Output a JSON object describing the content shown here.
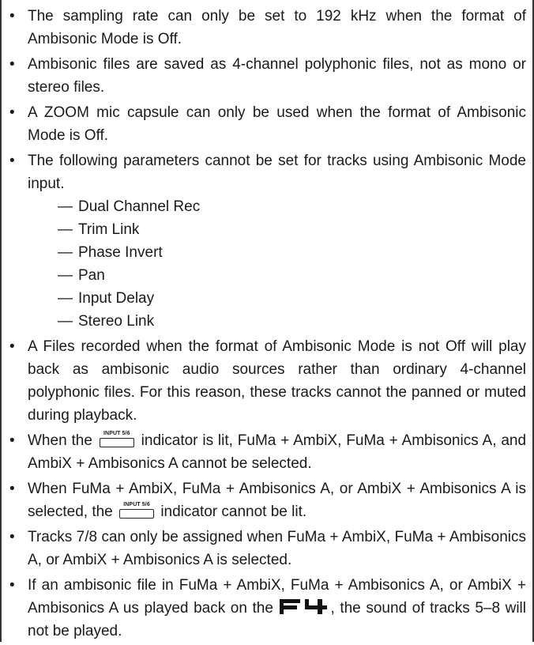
{
  "items": [
    "The sampling rate can only be set to 192 kHz when the format of Ambisonic Mode is Off.",
    "Ambisonic files are saved as 4-channel polyphonic files, not as mono or stereo files.",
    "A ZOOM mic capsule can only be used when the format of Ambi­sonic Mode is Off.",
    "The following parameters cannot be set for tracks using Ambisonic Mode input.",
    "A Files recorded when the format of Ambisonic Mode is not Off will play back as ambisonic audio sources rather than ordinary 4-channel polyphonic files. For this reason, these tracks cannot the panned or muted during playback.",
    "Tracks 7/8 can only be assigned when FuMa + AmbiX, FuMa + Ambi­sonics A, or AmbiX + Ambisonics A is selected."
  ],
  "sub_items": [
    "Dual Channel Rec",
    "Trim Link",
    "Phase Invert",
    "Pan",
    "Input Delay",
    "Stereo Link"
  ],
  "dash": "—",
  "indicator_label": "INPUT 5/6",
  "device_logo": "F4",
  "item6": {
    "before": "When the",
    "after": "indicator is lit, FuMa + AmbiX, FuMa + Ambisonics A, and AmbiX + Ambisonics A cannot be selected."
  },
  "item7": {
    "before": "When FuMa + AmbiX, FuMa + Ambisonics A, or AmbiX + Ambisonics A is selected, the",
    "after": "indicator cannot be lit."
  },
  "item9": {
    "before": "If an ambisonic file in FuMa + AmbiX, FuMa + Ambisonics A, or AmbiX + Ambisonics A us played back on the",
    "after": ", the sound of tracks 5–8 will not be played."
  }
}
